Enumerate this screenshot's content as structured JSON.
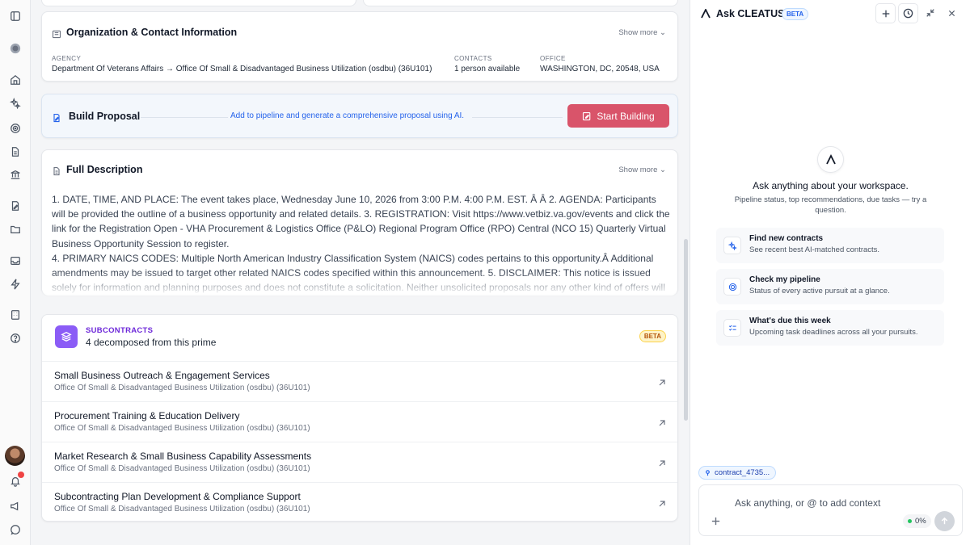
{
  "org_card": {
    "title": "Organization & Contact Information",
    "show_more": "Show more",
    "agency_label": "AGENCY",
    "agency_value": "Department Of Veterans Affairs → Office Of Small & Disadvantaged Business Utilization (osdbu) (36U101)",
    "contacts_label": "CONTACTS",
    "contacts_value": "1 person available",
    "office_label": "OFFICE",
    "office_value": "WASHINGTON, DC, 20548, USA"
  },
  "proposal": {
    "title": "Build Proposal",
    "link_text": "Add to pipeline and generate a comprehensive proposal using AI.",
    "button_label": "Start Building"
  },
  "description": {
    "title": "Full Description",
    "show_more": "Show more",
    "text": "1. DATE, TIME, AND PLACE: The event takes place, Wednesday June 10, 2026 from 3:00 P.M. 4:00 P.M. EST. Â Â  2. AGENDA: Participants will be provided the outline of a business opportunity and related details. 3. REGISTRATION: Visit https://www.vetbiz.va.gov/events and click the link for the Registration Open - VHA Procurement & Logistics Office (P&LO) Regional Program Office (RPO) Central (NCO 15) Quarterly Virtual Business Opportunity Session to register.",
    "text2": "4. PRIMARY NAICS CODES: Multiple North American Industry Classification System (NAICS) codes pertains to this opportunity.Â  Additional amendments may be issued to target other related NAICS codes specified within this announcement. 5. DISCLAIMER: This notice is issued solely for information and planning purposes and does not constitute a solicitation. Neither unsolicited proposals nor any other kind of offers will be"
  },
  "subcontracts": {
    "label": "SUBCONTRACTS",
    "count_text": "4 decomposed from this prime",
    "badge": "BETA",
    "items": [
      {
        "title": "Small Business Outreach & Engagement Services",
        "agency": "Office Of Small & Disadvantaged Business Utilization (osdbu) (36U101)"
      },
      {
        "title": "Procurement Training & Education Delivery",
        "agency": "Office Of Small & Disadvantaged Business Utilization (osdbu) (36U101)"
      },
      {
        "title": "Market Research & Small Business Capability Assessments",
        "agency": "Office Of Small & Disadvantaged Business Utilization (osdbu) (36U101)"
      },
      {
        "title": "Subcontracting Plan Development & Compliance Support",
        "agency": "Office Of Small & Disadvantaged Business Utilization (osdbu) (36U101)"
      }
    ]
  },
  "assistant": {
    "title": "Ask CLEATUS",
    "beta": "BETA",
    "hero_title": "Ask anything about your workspace.",
    "hero_sub": "Pipeline status, top recommendations, due tasks — try a question.",
    "suggestions": [
      {
        "title": "Find new contracts",
        "sub": "See recent best AI-matched contracts.",
        "icon": "sparkle-icon"
      },
      {
        "title": "Check my pipeline",
        "sub": "Status of every active pursuit at a glance.",
        "icon": "target-icon"
      },
      {
        "title": "What's due this week",
        "sub": "Upcoming task deadlines across all your pursuits.",
        "icon": "checklist-icon"
      }
    ],
    "context_chip": "contract_4735...",
    "input_placeholder": "Ask anything, or @ to add context",
    "usage": "0%"
  },
  "colors": {
    "accent_blue": "#2563eb",
    "start_button": "#d9546a",
    "subcontract_purple": "#8b5cf6",
    "notification": "#ef4444"
  }
}
